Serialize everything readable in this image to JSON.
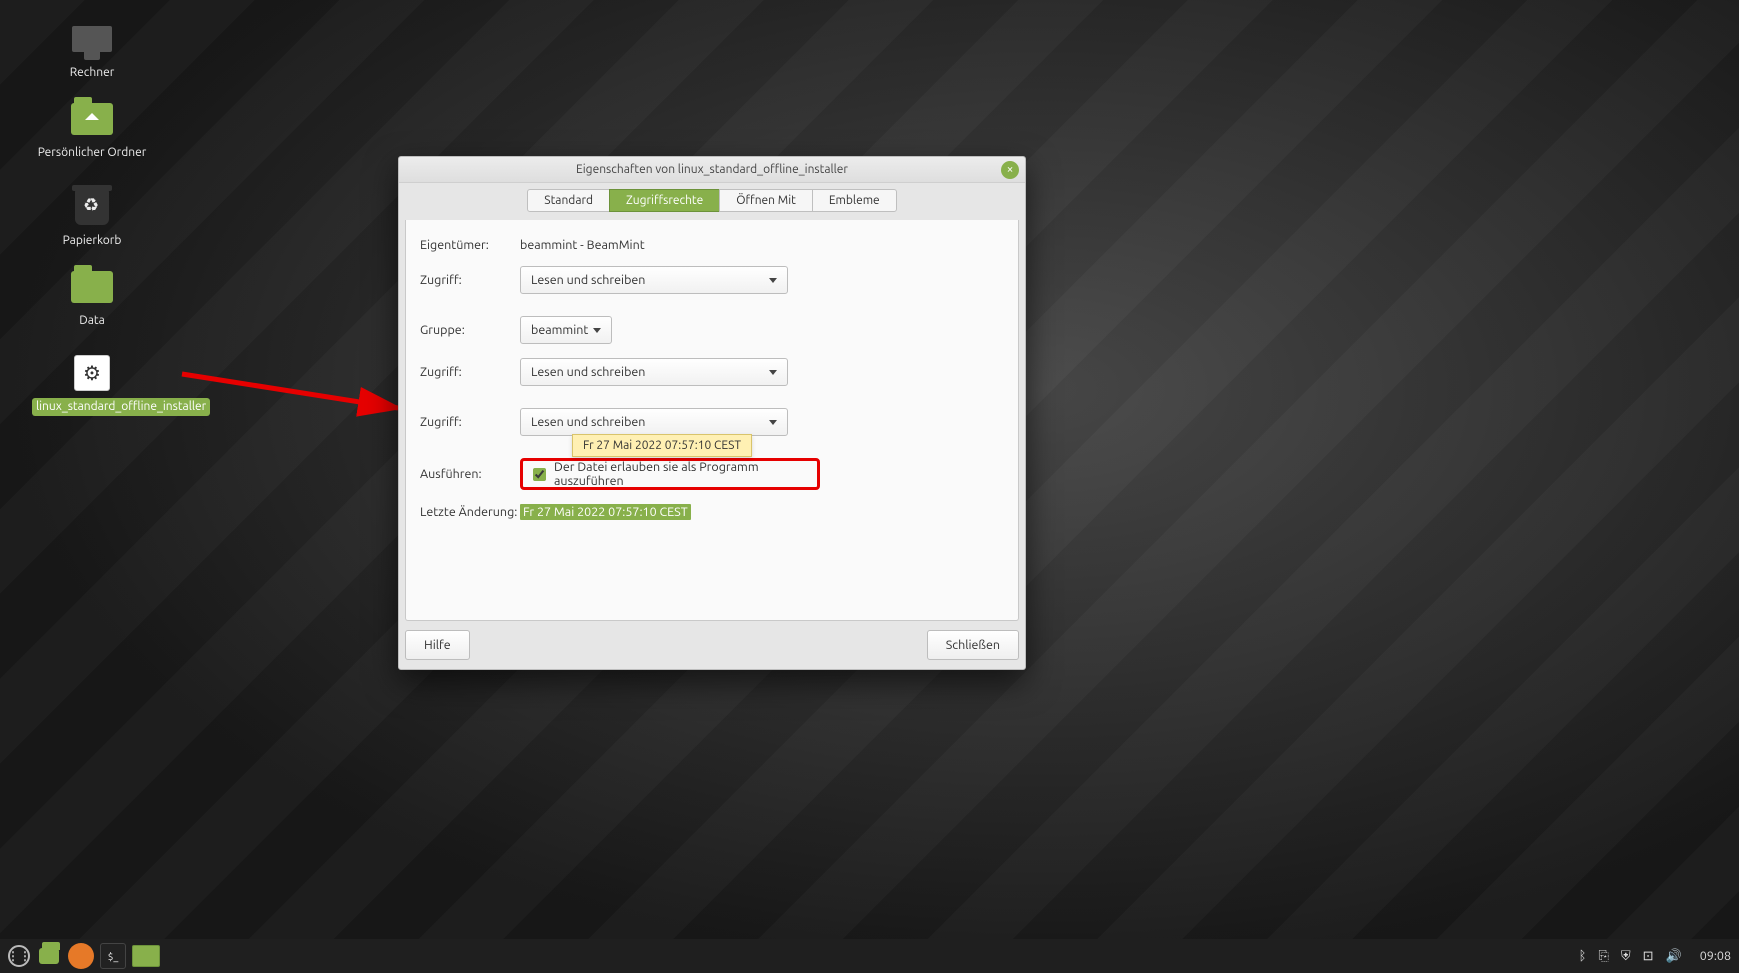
{
  "desktop": {
    "icons": [
      {
        "label": "Rechner"
      },
      {
        "label": "Persönlicher Ordner"
      },
      {
        "label": "Papierkorb"
      },
      {
        "label": "Data"
      },
      {
        "label": "linux_standard_offline_installer"
      }
    ]
  },
  "dialog": {
    "title": "Eigenschaften von linux_standard_offline_installer",
    "tabs": [
      {
        "label": "Standard"
      },
      {
        "label": "Zugriffsrechte",
        "active": true
      },
      {
        "label": "Öffnen Mit"
      },
      {
        "label": "Embleme"
      }
    ],
    "labels": {
      "owner": "Eigentümer:",
      "access": "Zugriff:",
      "group": "Gruppe:",
      "execute": "Ausführen:",
      "last_change": "Letzte Änderung:"
    },
    "owner_value": "beammint - BeamMint",
    "owner_access_value": "Lesen und schreiben",
    "group_value": "beammint",
    "group_access_value": "Lesen und schreiben",
    "others_access_value": "Lesen und schreiben",
    "execute_label": "Der Datei erlauben sie als Programm auszuführen",
    "execute_checked": true,
    "last_change_value": "Fr 27 Mai 2022 07:57:10 CEST",
    "tooltip_value": "Fr 27 Mai 2022 07:57:10 CEST",
    "buttons": {
      "help": "Hilfe",
      "close": "Schließen"
    }
  },
  "taskbar": {
    "clock": "09:08"
  }
}
